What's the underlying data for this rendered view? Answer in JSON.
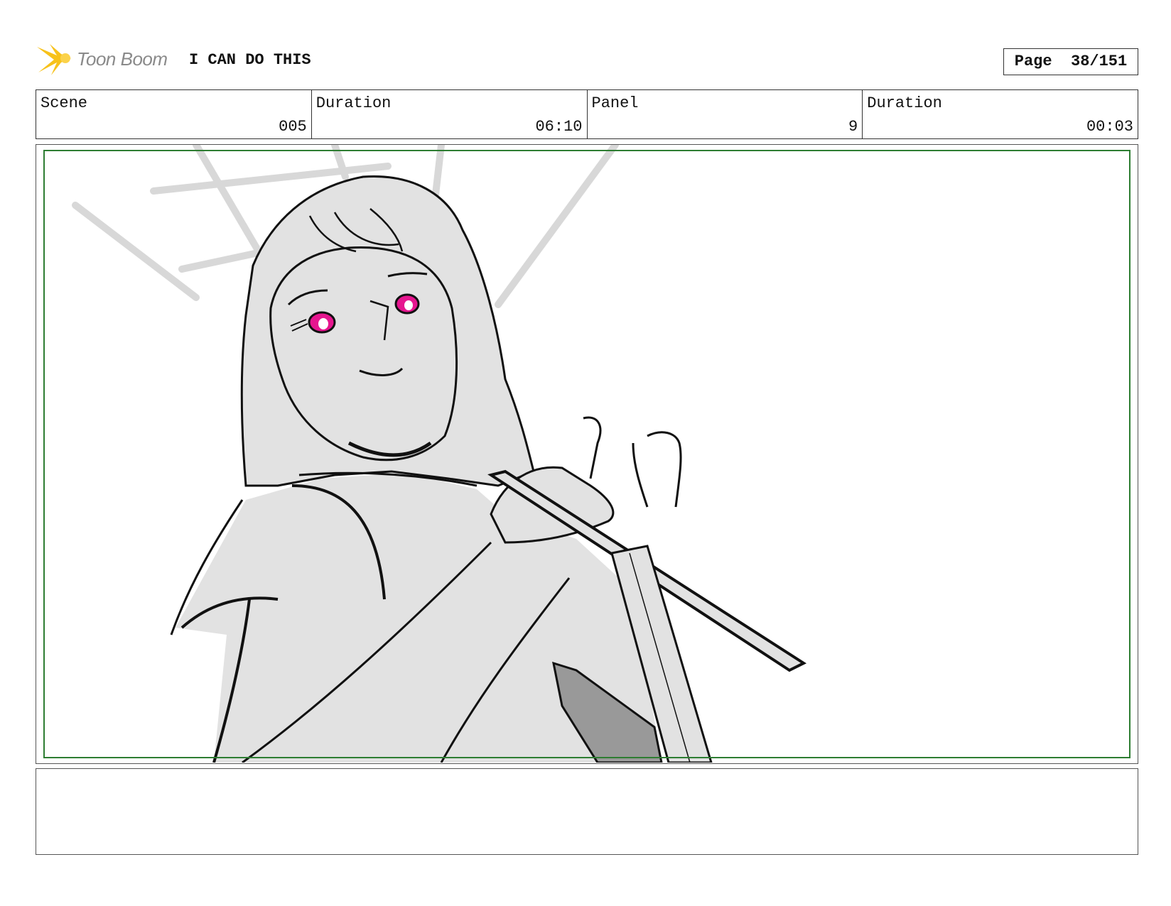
{
  "header": {
    "logo_text": "Toon Boom",
    "project_title": "I CAN DO THIS",
    "page_label": "Page",
    "page_value": "38/151"
  },
  "info": [
    {
      "label": "Scene",
      "value": "005"
    },
    {
      "label": "Duration",
      "value": "06:10"
    },
    {
      "label": "Panel",
      "value": "9"
    },
    {
      "label": "Duration",
      "value": "00:03"
    }
  ],
  "colors": {
    "safe_frame": "#2e7d32",
    "fill_gray": "#e2e2e2",
    "eye_magenta": "#e6168f",
    "logo_yellow": "#f7c21b"
  },
  "notes": {
    "text": ""
  }
}
